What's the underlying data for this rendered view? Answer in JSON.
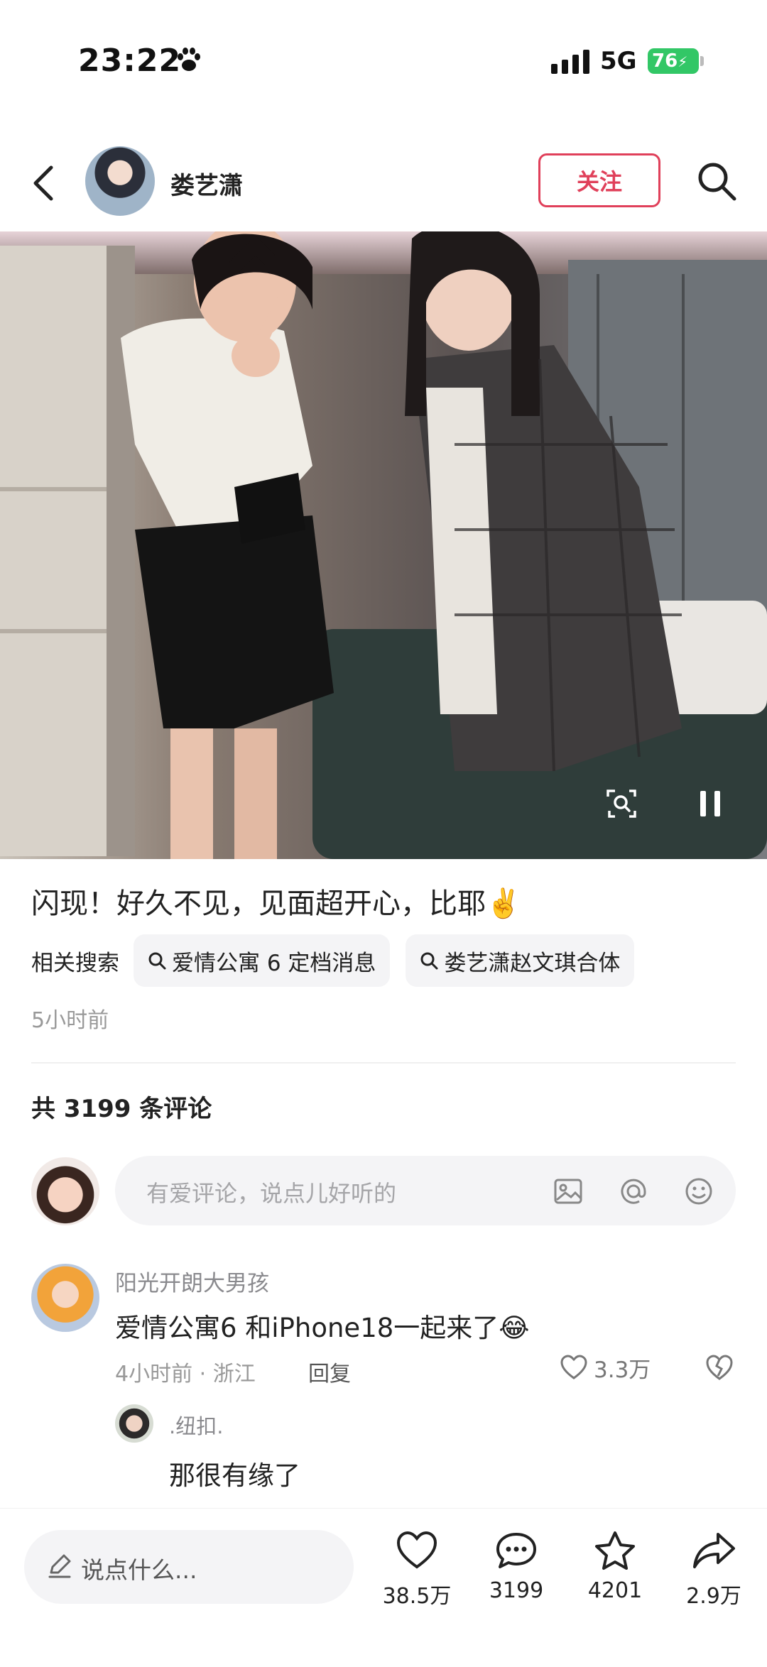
{
  "status_bar": {
    "time": "23:22",
    "network": "5G",
    "battery": "76",
    "signal_icon": "cellular-signal-icon",
    "paw_icon": "paw-icon"
  },
  "header": {
    "author_name": "娄艺潇",
    "follow_label": "关注",
    "back_icon": "back-chevron-icon",
    "search_icon": "search-icon"
  },
  "post": {
    "caption": "闪现！好久不见，见面超开心，比耶✌️",
    "related_label": "相关搜索",
    "related_searches": [
      "爱情公寓 6 定档消息",
      "娄艺潇赵文琪合体"
    ],
    "time_ago": "5小时前"
  },
  "comments": {
    "count_label": "共 3199 条评论",
    "input_placeholder": "有爱评论，说点儿好听的",
    "items": [
      {
        "user": "阳光开朗大男孩",
        "text": "爱情公寓6 和iPhone18一起来了😂",
        "meta": "4小时前 · 浙江",
        "reply_label": "回复",
        "likes": "3.3万",
        "replies": [
          {
            "user": ".纽扣.",
            "text": "那很有缘了"
          }
        ]
      }
    ]
  },
  "bottom_bar": {
    "say_placeholder": "说点什么...",
    "likes": "38.5万",
    "comments": "3199",
    "favorites": "4201",
    "shares": "2.9万"
  },
  "colors": {
    "accent": "#e0405a",
    "battery": "#32c766",
    "chip_bg": "#f4f4f6"
  }
}
